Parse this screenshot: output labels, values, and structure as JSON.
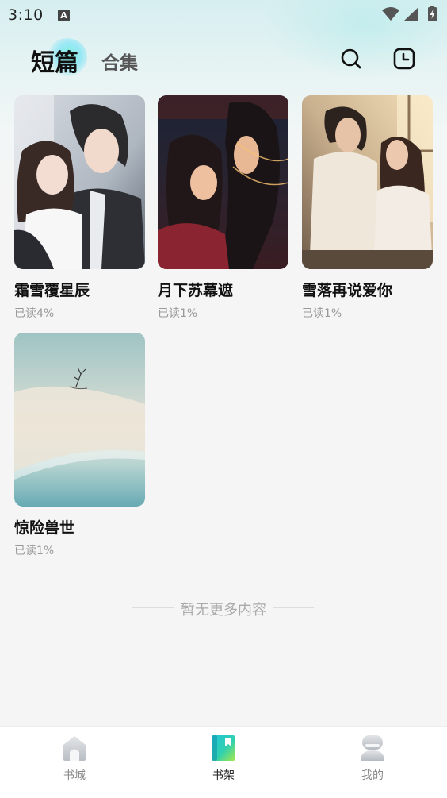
{
  "status_bar": {
    "time": "3:10",
    "notification_letter": "A"
  },
  "header": {
    "tabs": [
      {
        "label": "短篇",
        "active": true
      },
      {
        "label": "合集",
        "active": false
      }
    ],
    "search_icon": "search-icon",
    "history_icon": "clock-icon"
  },
  "books": [
    {
      "title": "霜雪覆星辰",
      "progress": "已读4%"
    },
    {
      "title": "月下苏幕遮",
      "progress": "已读1%"
    },
    {
      "title": "雪落再说爱你",
      "progress": "已读1%"
    },
    {
      "title": "惊险兽世",
      "progress": "已读1%"
    }
  ],
  "list_end_text": "暂无更多内容",
  "bottom_nav": {
    "items": [
      {
        "label": "书城",
        "icon": "house-icon",
        "active": false
      },
      {
        "label": "书架",
        "icon": "bookshelf-icon",
        "active": true
      },
      {
        "label": "我的",
        "icon": "profile-icon",
        "active": false
      }
    ]
  },
  "colors": {
    "accent": "#2fd0b0",
    "background": "#f5f5f5",
    "text_secondary": "#999999"
  }
}
